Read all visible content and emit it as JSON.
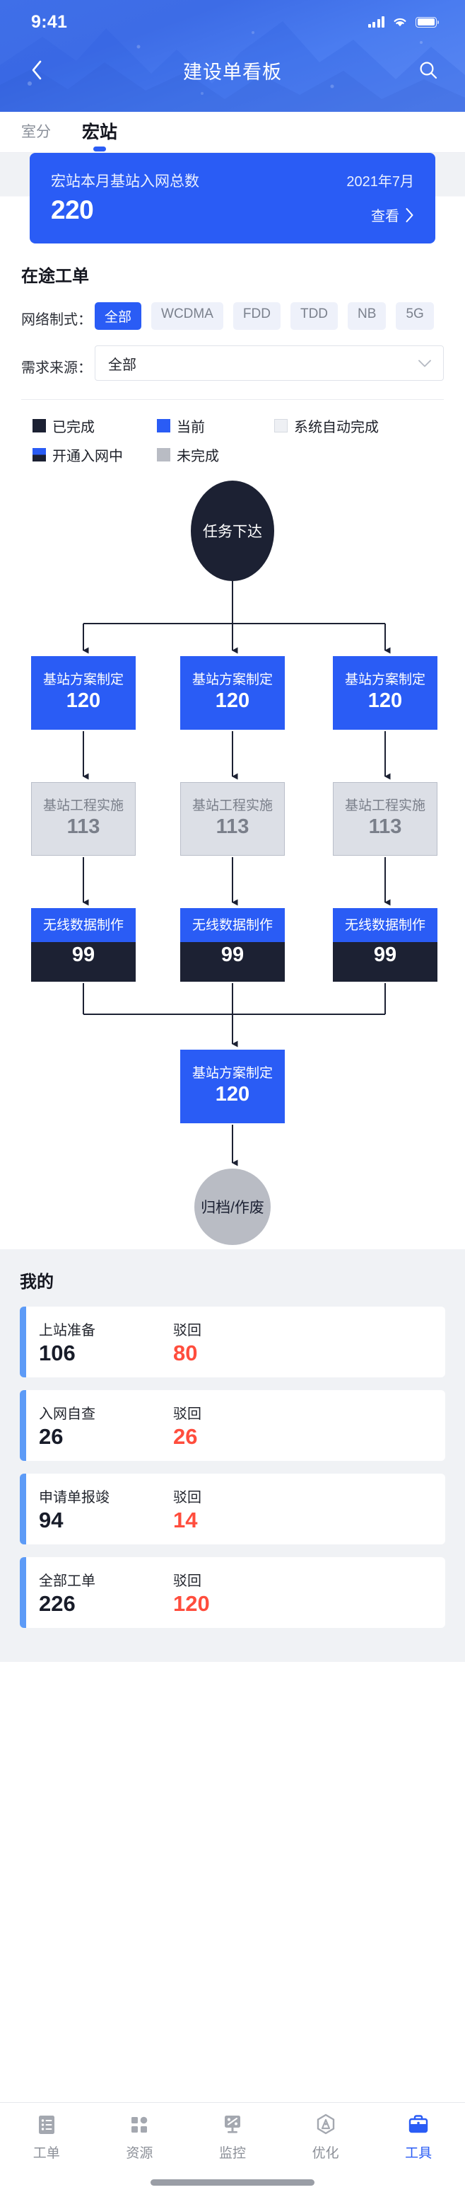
{
  "status_bar": {
    "time": "9:41",
    "signal_icon": "cellular-signal-icon",
    "wifi_icon": "wifi-icon",
    "battery_icon": "battery-icon"
  },
  "nav": {
    "back_icon": "chevron-left-icon",
    "title": "建设单看板",
    "search_icon": "search-icon"
  },
  "tabs": [
    {
      "label": "室分",
      "active": false
    },
    {
      "label": "宏站",
      "active": true
    }
  ],
  "summary": {
    "label": "宏站本月基站入网总数",
    "date": "2021年7月",
    "value": "220",
    "link": "查看",
    "link_icon": "chevron-right-icon",
    "color": "#2a5cf5"
  },
  "inflight": {
    "title": "在途工单",
    "network_label": "网络制式：",
    "chips": [
      {
        "label": "全部",
        "active": true
      },
      {
        "label": "WCDMA",
        "active": false
      },
      {
        "label": "FDD",
        "active": false
      },
      {
        "label": "TDD",
        "active": false
      },
      {
        "label": "NB",
        "active": false
      },
      {
        "label": "5G",
        "active": false
      }
    ],
    "source_label": "需求来源：",
    "source_value": "全部",
    "source_caret_icon": "chevron-down-icon"
  },
  "legend": [
    {
      "label": "已完成",
      "color": "#1c2133",
      "style": "solid"
    },
    {
      "label": "当前",
      "color": "#2a5cf5",
      "style": "solid"
    },
    {
      "label": "系统自动完成",
      "color": "#e6e9ef",
      "style": "outline"
    },
    {
      "label": "开通入网中",
      "color": "#2a5cf5",
      "color2": "#1c2133",
      "style": "split"
    },
    {
      "label": "未完成",
      "color": "#b9bcc4",
      "style": "solid"
    }
  ],
  "flow": {
    "start": {
      "label": "任务下达",
      "type": "ellipse-dark"
    },
    "row1": [
      {
        "label": "基站方案制定",
        "value": "120",
        "type": "blue"
      },
      {
        "label": "基站方案制定",
        "value": "120",
        "type": "blue"
      },
      {
        "label": "基站方案制定",
        "value": "120",
        "type": "blue"
      }
    ],
    "row2": [
      {
        "label": "基站工程实施",
        "value": "113",
        "type": "gray"
      },
      {
        "label": "基站工程实施",
        "value": "113",
        "type": "gray"
      },
      {
        "label": "基站工程实施",
        "value": "113",
        "type": "gray"
      }
    ],
    "row3": [
      {
        "label": "无线数据制作",
        "value": "99",
        "type": "split"
      },
      {
        "label": "无线数据制作",
        "value": "99",
        "type": "split"
      },
      {
        "label": "无线数据制作",
        "value": "99",
        "type": "split"
      }
    ],
    "merge": {
      "label": "基站方案制定",
      "value": "120",
      "type": "blue"
    },
    "end": {
      "label": "归档/作废",
      "type": "circle-gray"
    }
  },
  "mine": {
    "title": "我的",
    "reject_label": "驳回",
    "cards": [
      {
        "label": "上站准备",
        "value": "106",
        "reject_label": "驳回",
        "reject_value": "80"
      },
      {
        "label": "入网自查",
        "value": "26",
        "reject_label": "驳回",
        "reject_value": "26"
      },
      {
        "label": "申请单报竣",
        "value": "94",
        "reject_label": "驳回",
        "reject_value": "14"
      },
      {
        "label": "全部工单",
        "value": "226",
        "reject_label": "驳回",
        "reject_value": "120"
      }
    ]
  },
  "bottom_nav": [
    {
      "label": "工单",
      "icon": "list-icon",
      "active": false
    },
    {
      "label": "资源",
      "icon": "grid-icon",
      "active": false
    },
    {
      "label": "监控",
      "icon": "monitor-icon",
      "active": false
    },
    {
      "label": "优化",
      "icon": "hexagon-icon",
      "active": false
    },
    {
      "label": "工具",
      "icon": "toolbox-icon",
      "active": true
    }
  ]
}
